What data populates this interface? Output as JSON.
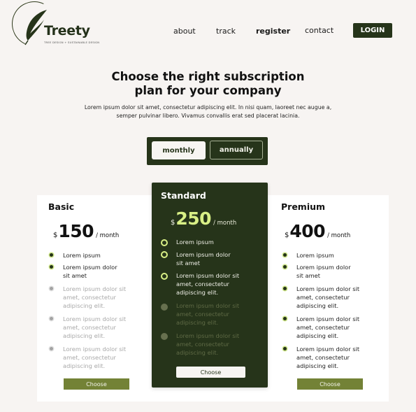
{
  "brand": {
    "name": "Treety",
    "tagline": "TREE DESIGN + SUSTAINABLE DESIGN"
  },
  "nav": {
    "links": [
      "about",
      "track",
      "register",
      "contact"
    ],
    "login": "LOGIN"
  },
  "hero": {
    "title_line1": "Choose the right subscription",
    "title_line2": "plan for your company",
    "subtitle_line1": "Lorem ipsum dolor sit amet, consectetur adipiscing elit. In nisi quam, laoreet nec augue a,",
    "subtitle_line2": "semper pulvinar libero. Vivamus convallis erat sed placerat lacinia."
  },
  "billing_toggle": {
    "monthly": "monthly",
    "annually": "annually",
    "selected": "monthly"
  },
  "plans": {
    "basic": {
      "name": "Basic",
      "currency": "$",
      "price": "150",
      "period": "/ month",
      "features": [
        {
          "line1": "Lorem ipsum",
          "line2": "",
          "line3": ""
        },
        {
          "line1": "Lorem ipsum dolor",
          "line2": "sit amet",
          "line3": ""
        },
        {
          "line1": "Lorem ipsum dolor sit",
          "line2": "amet, consectetur",
          "line3": "adipiscing elit."
        },
        {
          "line1": "Lorem ipsum dolor sit",
          "line2": "amet, consectetur",
          "line3": "adipiscing elit."
        },
        {
          "line1": "Lorem ipsum dolor sit",
          "line2": "amet, consectetur",
          "line3": "adipiscing elit."
        }
      ],
      "choose": "Choose"
    },
    "standard": {
      "name": "Standard",
      "currency": "$",
      "price": "250",
      "period": "/ month",
      "features": [
        {
          "line1": "Lorem ipsum",
          "line2": "",
          "line3": ""
        },
        {
          "line1": "Lorem ipsum dolor",
          "line2": "sit amet",
          "line3": ""
        },
        {
          "line1": "Lorem ipsum dolor sit",
          "line2": "amet, consectetur",
          "line3": "adipiscing elit."
        },
        {
          "line1": "Lorem ipsum dolor sit",
          "line2": "amet, consectetur",
          "line3": "adipiscing elit."
        },
        {
          "line1": "Lorem ipsum dolor sit",
          "line2": "amet, consectetur",
          "line3": "adipiscing elit."
        }
      ],
      "choose": "Choose"
    },
    "premium": {
      "name": "Premium",
      "currency": "$",
      "price": "400",
      "period": "/ month",
      "features": [
        {
          "line1": "Lorem ipsum",
          "line2": "",
          "line3": ""
        },
        {
          "line1": "Lorem ipsum dolor",
          "line2": "sit amet",
          "line3": ""
        },
        {
          "line1": "Lorem ipsum dolor sit",
          "line2": "amet, consectetur",
          "line3": "adipiscing elit."
        },
        {
          "line1": "Lorem ipsum dolor sit",
          "line2": "amet, consectetur",
          "line3": "adipiscing elit."
        },
        {
          "line1": "Lorem ipsum dolor sit",
          "line2": "amet, consectetur",
          "line3": "adipiscing elit."
        }
      ],
      "choose": "Choose"
    }
  },
  "colors": {
    "primary": "#26341a",
    "accent": "#738236",
    "highlight": "#d8ef86",
    "background": "#f7f4f2"
  }
}
